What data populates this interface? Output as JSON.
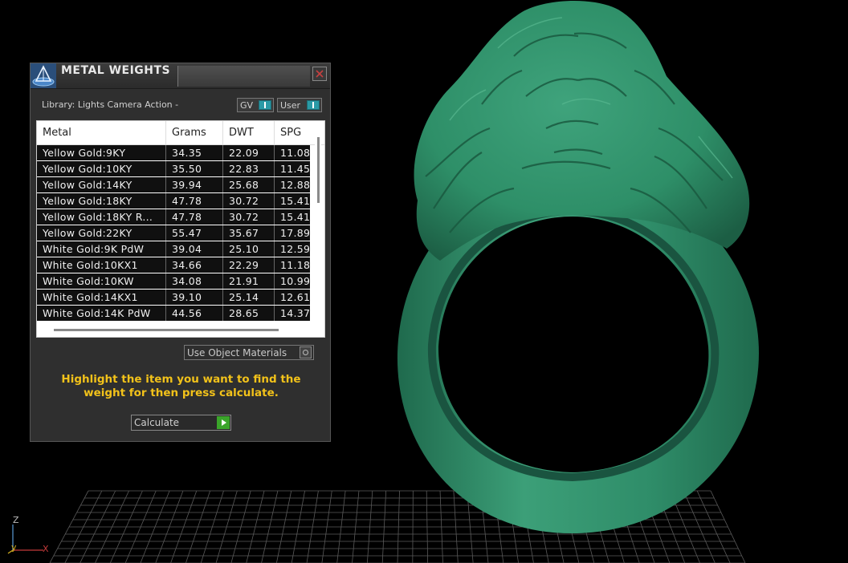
{
  "panel": {
    "title": "METAL WEIGHTS",
    "library_label": "Library: Lights Camera Action -",
    "toggles": [
      {
        "label": "GV",
        "state": "on"
      },
      {
        "label": "User",
        "state": "on"
      }
    ],
    "table": {
      "columns": [
        "Metal",
        "Grams",
        "DWT",
        "SPG"
      ],
      "rows": [
        [
          "Yellow Gold:9KY",
          "34.35",
          "22.09",
          "11.08"
        ],
        [
          "Yellow Gold:10KY",
          "35.50",
          "22.83",
          "11.45"
        ],
        [
          "Yellow Gold:14KY",
          "39.94",
          "25.68",
          "12.88"
        ],
        [
          "Yellow Gold:18KY",
          "47.78",
          "30.72",
          "15.41"
        ],
        [
          "Yellow Gold:18KY R...",
          "47.78",
          "30.72",
          "15.41"
        ],
        [
          "Yellow Gold:22KY",
          "55.47",
          "35.67",
          "17.89"
        ],
        [
          "White Gold:9K PdW",
          "39.04",
          "25.10",
          "12.59"
        ],
        [
          "White Gold:10KX1",
          "34.66",
          "22.29",
          "11.18"
        ],
        [
          "White Gold:10KW",
          "34.08",
          "21.91",
          "10.99"
        ],
        [
          "White Gold:14KX1",
          "39.10",
          "25.14",
          "12.61"
        ],
        [
          "White Gold:14K PdW",
          "44.56",
          "28.65",
          "14.37"
        ]
      ]
    },
    "use_object_materials_label": "Use Object Materials",
    "hint": "Highlight the item you want to find the weight for then press calculate.",
    "calculate_label": "Calculate"
  },
  "viewport": {
    "axis_labels": {
      "z": "Z",
      "x": "X",
      "y": "y"
    },
    "model_color": "#2e8f68"
  },
  "colors": {
    "hint": "#f2c21a",
    "toggle_on": "#2a9aa6",
    "calculate_icon": "#3aa52a"
  }
}
